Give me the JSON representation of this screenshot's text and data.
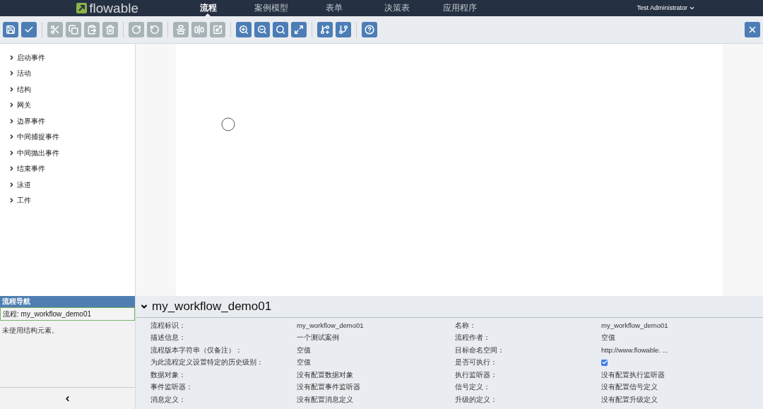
{
  "header": {
    "logo": "flowable",
    "nav": [
      {
        "label": "流程",
        "selected": true
      },
      {
        "label": "案例模型",
        "selected": false
      },
      {
        "label": "表单",
        "selected": false
      },
      {
        "label": "决策表",
        "selected": false
      },
      {
        "label": "应用程序",
        "selected": false
      }
    ],
    "user": "Test Administrator"
  },
  "toolbar": {
    "groups": [
      [
        {
          "kind": "save",
          "disabled": false
        },
        {
          "kind": "validate",
          "disabled": false
        }
      ],
      [
        {
          "kind": "cut",
          "disabled": true
        },
        {
          "kind": "copy",
          "disabled": true
        },
        {
          "kind": "paste",
          "disabled": true
        },
        {
          "kind": "delete",
          "disabled": true
        }
      ],
      [
        {
          "kind": "redo",
          "disabled": true
        },
        {
          "kind": "undo",
          "disabled": true
        }
      ],
      [
        {
          "kind": "align-horizontal",
          "disabled": true
        },
        {
          "kind": "align-vertical",
          "disabled": true
        },
        {
          "kind": "same-size",
          "disabled": true
        }
      ],
      [
        {
          "kind": "zoom-in",
          "disabled": false
        },
        {
          "kind": "zoom-out",
          "disabled": false
        },
        {
          "kind": "zoom-actual",
          "disabled": false
        },
        {
          "kind": "zoom-fit",
          "disabled": false
        }
      ],
      [
        {
          "kind": "add-bendpoint",
          "disabled": false
        },
        {
          "kind": "remove-bendpoint",
          "disabled": false
        }
      ],
      [
        {
          "kind": "help",
          "disabled": false
        }
      ]
    ],
    "close": {
      "kind": "close",
      "disabled": false
    }
  },
  "palette": {
    "items": [
      {
        "label": "启动事件",
        "expanded": false
      },
      {
        "label": "活动",
        "expanded": false
      },
      {
        "label": "结构",
        "expanded": false
      },
      {
        "label": "网关",
        "expanded": false
      },
      {
        "label": "边界事件",
        "expanded": false
      },
      {
        "label": "中间捕捉事件",
        "expanded": false
      },
      {
        "label": "中间抛出事件",
        "expanded": false
      },
      {
        "label": "结束事件",
        "expanded": false
      },
      {
        "label": "泳道",
        "expanded": false
      },
      {
        "label": "工件",
        "expanded": false
      }
    ]
  },
  "navigator": {
    "title": "流程导航",
    "items": [
      {
        "label": "流程: my_workflow_demo01",
        "selected": true
      }
    ],
    "note": "未使用结构元素。"
  },
  "properties": {
    "title": "my_workflow_demo01",
    "expanded": true,
    "rows": [
      [
        {
          "label": "流程标识：",
          "kind": "text",
          "value": "my_workflow_demo01"
        },
        {
          "label": "名称：",
          "kind": "text",
          "value": "my_workflow_demo01"
        }
      ],
      [
        {
          "label": "描述信息：",
          "kind": "text",
          "value": "一个测试案例"
        },
        {
          "label": "流程作者：",
          "kind": "text",
          "value": "空值"
        }
      ],
      [
        {
          "label": "流程版本字符串（仅备注）：",
          "kind": "text",
          "value": "空值"
        },
        {
          "label": "目标命名空间：",
          "kind": "text",
          "value": "http://www.flowable. ..."
        }
      ],
      [
        {
          "label": "为此流程定义设置特定的历史级别：",
          "kind": "text",
          "value": "空值"
        },
        {
          "label": "是否可执行：",
          "kind": "checkbox",
          "checked": true
        }
      ],
      [
        {
          "label": "数据对象：",
          "kind": "text",
          "value": "没有配置数据对象"
        },
        {
          "label": "执行监听器：",
          "kind": "text",
          "value": "没有配置执行监听器"
        }
      ],
      [
        {
          "label": "事件监听器：",
          "kind": "text",
          "value": "没有配置事件监听器"
        },
        {
          "label": "信号定义：",
          "kind": "text",
          "value": "没有配置信号定义"
        }
      ],
      [
        {
          "label": "消息定义：",
          "kind": "text",
          "value": "没有配置消息定义"
        },
        {
          "label": "升级的定义：",
          "kind": "text",
          "value": "没有配置升级定义"
        }
      ]
    ]
  }
}
